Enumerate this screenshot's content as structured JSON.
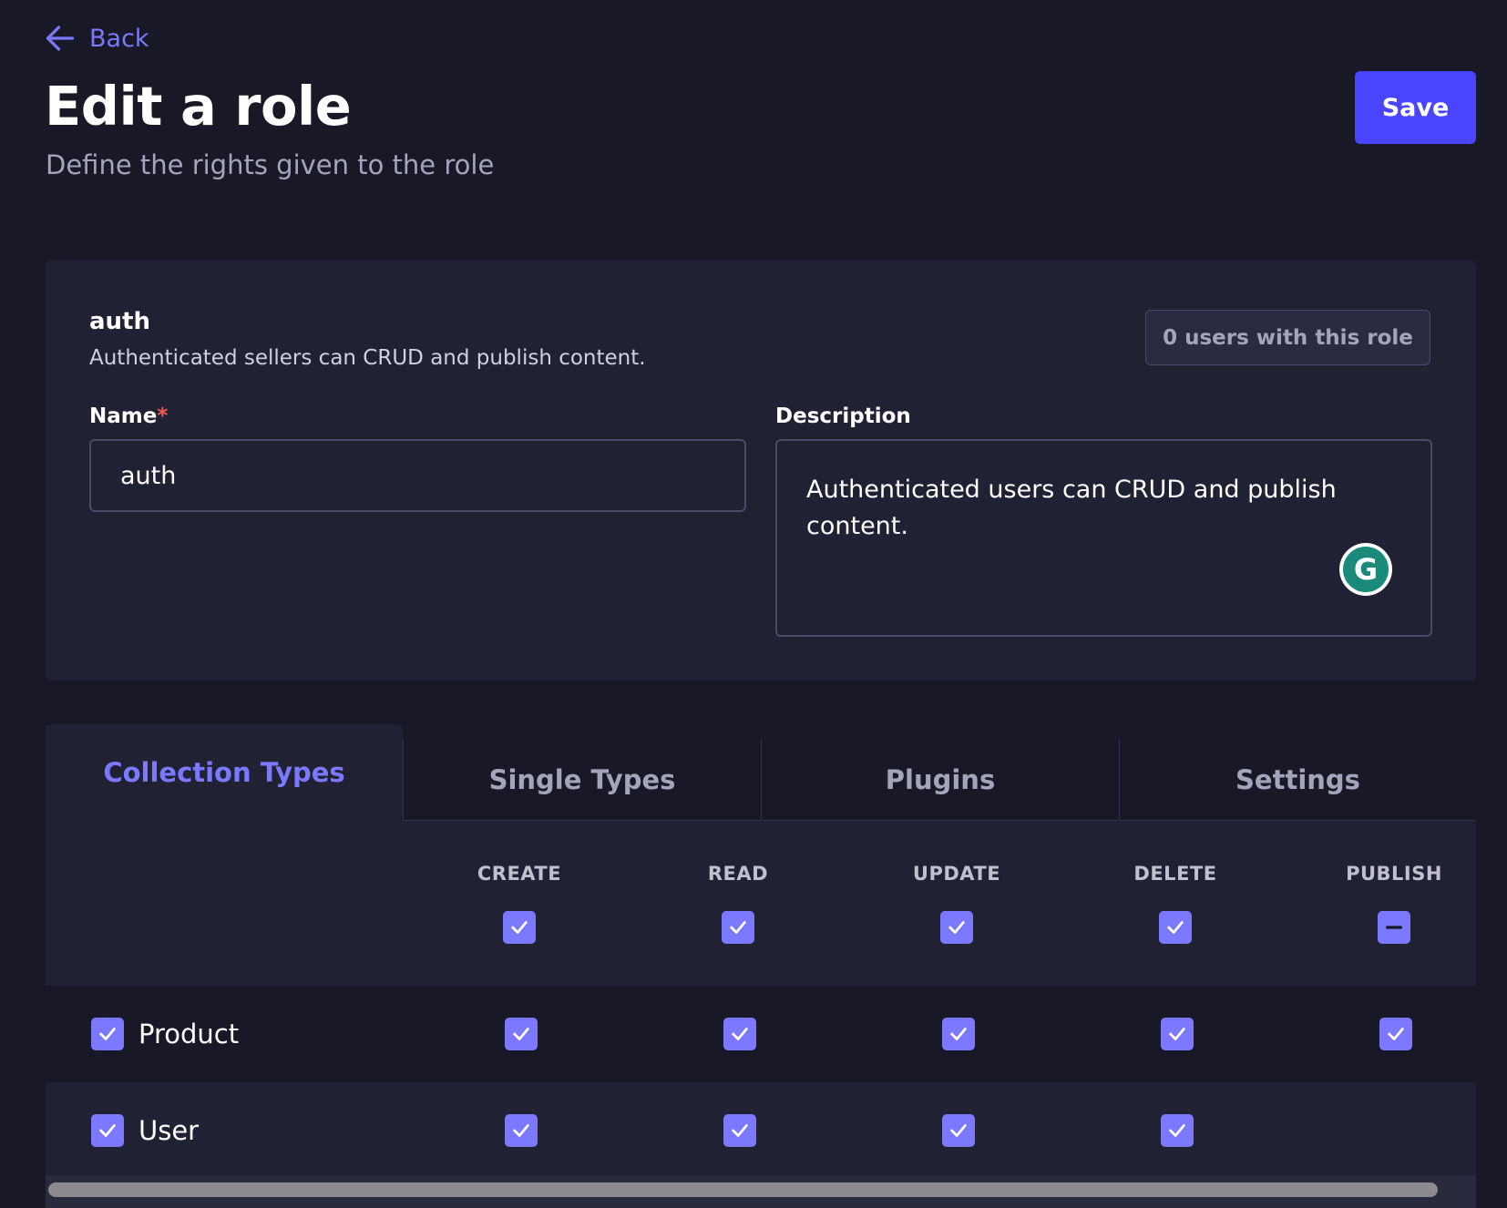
{
  "header": {
    "back_label": "Back",
    "title": "Edit a role",
    "subtitle": "Define the rights given to the role",
    "save_label": "Save"
  },
  "role": {
    "name": "auth",
    "description": "Authenticated sellers can CRUD and publish content.",
    "users_badge": "0 users with this role"
  },
  "form": {
    "name_label": "Name",
    "required_mark": "*",
    "name_value": "auth",
    "description_label": "Description",
    "description_value": "Authenticated users can CRUD and publish content."
  },
  "tabs": [
    {
      "label": "Collection Types",
      "active": true
    },
    {
      "label": "Single Types",
      "active": false
    },
    {
      "label": "Plugins",
      "active": false
    },
    {
      "label": "Settings",
      "active": false
    }
  ],
  "permissions": {
    "columns": [
      "CREATE",
      "READ",
      "UPDATE",
      "DELETE",
      "PUBLISH"
    ],
    "column_states": [
      "checked",
      "checked",
      "checked",
      "checked",
      "indeterminate"
    ],
    "rows": [
      {
        "label": "Product",
        "checked": true,
        "states": [
          "checked",
          "checked",
          "checked",
          "checked",
          "checked"
        ]
      },
      {
        "label": "User",
        "checked": true,
        "states": [
          "checked",
          "checked",
          "checked",
          "checked",
          null
        ]
      }
    ]
  },
  "icons": {
    "back": "arrow-left-icon",
    "checkbox": "check-icon",
    "indeterminate": "minus-icon",
    "grammarly": "grammarly-icon"
  },
  "colors": {
    "background": "#181826",
    "card": "#212134",
    "primary": "#4945ff",
    "accent": "#7b79ff",
    "required": "#ee5e52"
  }
}
